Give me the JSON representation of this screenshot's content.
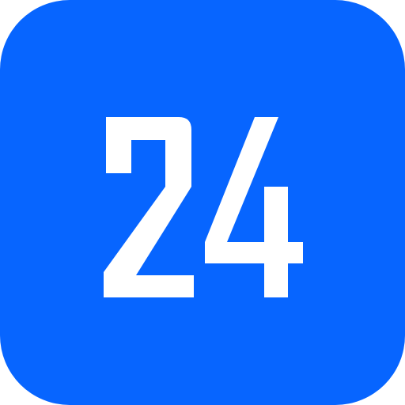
{
  "tile": {
    "number": "24",
    "background_color": "#0765FF",
    "glyph_color": "#FFFFFF"
  }
}
